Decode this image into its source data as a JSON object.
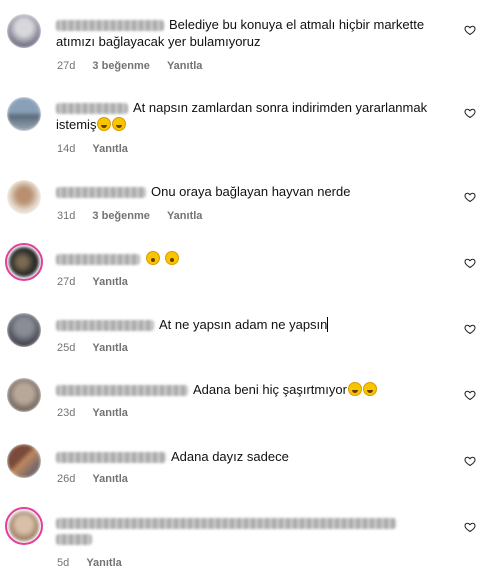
{
  "comments": [
    {
      "text": "Belediye bu konuya el atmalı hiçbir markette atımızı bağlayacak yer bulamıyoruz",
      "time": "27d",
      "likes": "3 beğenme",
      "reply": "Yanıtla",
      "avatar_colors": [
        "#d8d8dc",
        "#6a6a80"
      ]
    },
    {
      "text": "At napsın zamlardan sonra indirimden yararlanmak istemiş",
      "time": "14d",
      "reply": "Yanıtla",
      "avatar_colors": [
        "#6d7f96",
        "#9aa9b6"
      ]
    },
    {
      "text": "Onu oraya bağlayan hayvan nerde",
      "time": "31d",
      "likes": "3 beğenme",
      "reply": "Yanıtla",
      "avatar_colors": [
        "#e8ddd0",
        "#b89070"
      ]
    },
    {
      "text": "",
      "time": "27d",
      "reply": "Yanıtla",
      "avatar_colors": [
        "#2a2a2a",
        "#7a6a50"
      ]
    },
    {
      "text": "At ne yapsın adam ne yapsın",
      "time": "25d",
      "reply": "Yanıtla",
      "avatar_colors": [
        "#3d4048",
        "#8a8d95"
      ]
    },
    {
      "text": "Adana beni hiç şaşırtmıyor",
      "time": "23d",
      "reply": "Yanıtla",
      "avatar_colors": [
        "#b7a89a",
        "#5d5048"
      ]
    },
    {
      "text": "Adana dayız sadece",
      "time": "26d",
      "reply": "Yanıtla",
      "avatar_colors": [
        "#7a4a3a",
        "#3a4a6a"
      ]
    },
    {
      "text": "",
      "time": "5d",
      "reply": "Yanıtla",
      "avatar_colors": [
        "#d8c0a8",
        "#8a6a50"
      ]
    }
  ],
  "icons": {
    "like": "heart-icon",
    "laugh": "grinning-face-with-sweat-emoji",
    "wow": "astonished-face-emoji"
  }
}
